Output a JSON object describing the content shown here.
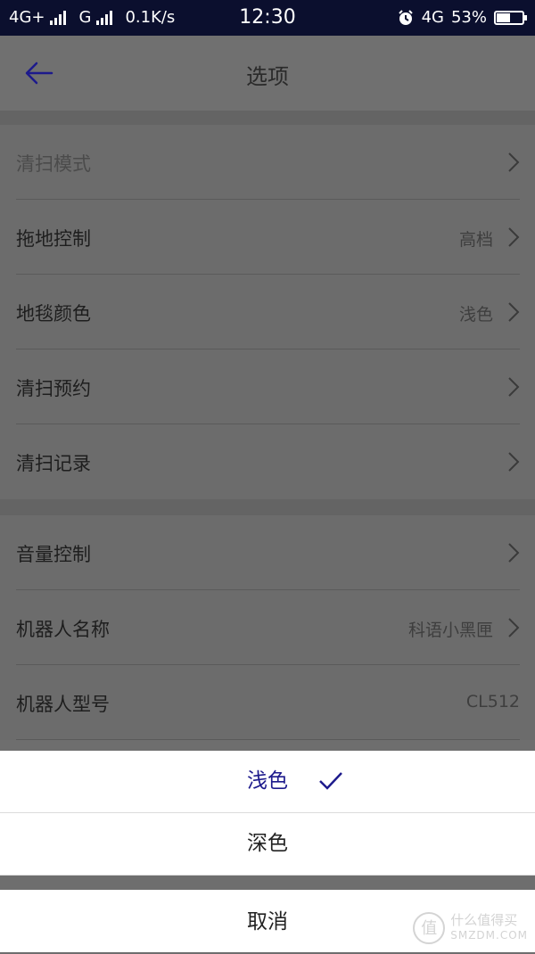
{
  "status_bar": {
    "network1": "4G+",
    "network2": "G",
    "speed": "0.1K/s",
    "time": "12:30",
    "network3": "4G",
    "battery_percent": "53%",
    "battery_level": 0.53
  },
  "header": {
    "title": "选项",
    "back_icon": "arrow-left-icon"
  },
  "groups": [
    {
      "items": [
        {
          "label": "清扫模式",
          "value": ""
        },
        {
          "label": "拖地控制",
          "value": "高档"
        },
        {
          "label": "地毯颜色",
          "value": "浅色"
        },
        {
          "label": "清扫预约",
          "value": ""
        },
        {
          "label": "清扫记录",
          "value": ""
        }
      ]
    },
    {
      "items": [
        {
          "label": "音量控制",
          "value": ""
        },
        {
          "label": "机器人名称",
          "value": "科语小黑匣"
        },
        {
          "label": "机器人型号",
          "value": "CL512"
        }
      ]
    }
  ],
  "sheet": {
    "options": [
      {
        "label": "浅色",
        "selected": true
      },
      {
        "label": "深色",
        "selected": false
      }
    ],
    "cancel": "取消"
  },
  "watermark": {
    "badge": "值",
    "line1": "什么值得买",
    "line2": "SMZDM.COM"
  },
  "colors": {
    "accent": "#1d1a8c",
    "status_bar": "#0b0f2e"
  }
}
